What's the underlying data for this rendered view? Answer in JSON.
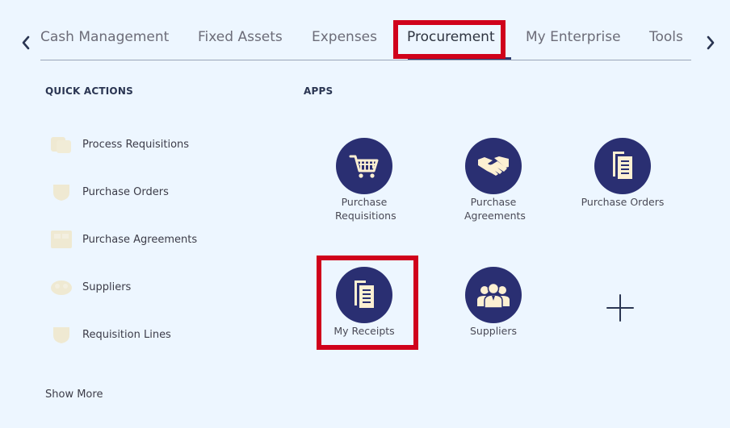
{
  "tabs": [
    {
      "label": "Cash Management"
    },
    {
      "label": "Fixed Assets"
    },
    {
      "label": "Expenses"
    },
    {
      "label": "Procurement",
      "active": true
    },
    {
      "label": "My Enterprise"
    },
    {
      "label": "Tools"
    }
  ],
  "quick_actions": {
    "title": "QUICK ACTIONS",
    "items": [
      {
        "label": "Process Requisitions",
        "icon": "process-requisitions-icon"
      },
      {
        "label": "Purchase Orders",
        "icon": "purchase-orders-icon"
      },
      {
        "label": "Purchase Agreements",
        "icon": "purchase-agreements-icon"
      },
      {
        "label": "Suppliers",
        "icon": "suppliers-icon"
      },
      {
        "label": "Requisition Lines",
        "icon": "requisition-lines-icon"
      }
    ],
    "show_more": "Show More"
  },
  "apps": {
    "title": "APPS",
    "items": [
      {
        "label": "Purchase Requisitions",
        "icon": "shopping-cart-icon"
      },
      {
        "label": "Purchase Agreements",
        "icon": "handshake-icon"
      },
      {
        "label": "Purchase Orders",
        "icon": "documents-icon"
      },
      {
        "label": "My Receipts",
        "icon": "documents-icon"
      },
      {
        "label": "Suppliers",
        "icon": "people-group-icon"
      }
    ],
    "add_icon": "plus-icon"
  },
  "colors": {
    "background": "#edf6ff",
    "app_circle": "#2a2f72",
    "icon_fill": "#fdf0d2",
    "highlight": "#d0021b",
    "active_tab_underline": "#2d3a6e"
  }
}
